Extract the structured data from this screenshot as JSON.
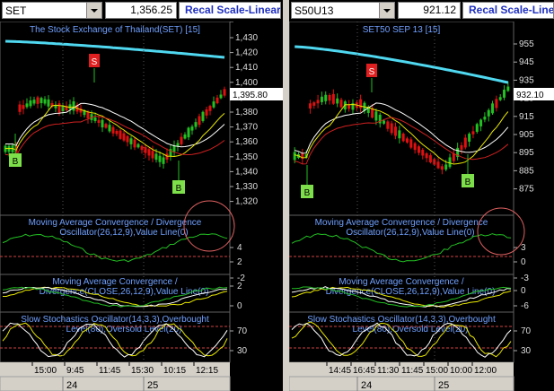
{
  "left": {
    "symbol": "SET",
    "price": "1,356.25",
    "recal_label": "Recal Scale-Linear",
    "main_title": "The Stock Exchange of Thailand(SET) [15]",
    "price_axis": [
      "1,430",
      "1,420",
      "1,410",
      "1,400",
      "1,390",
      "1,380",
      "1,370",
      "1,360",
      "1,350",
      "1,340",
      "1,330",
      "1,320"
    ],
    "last_price_tag": "1,395.80",
    "sell_label": "S",
    "buy_labels": [
      "B",
      "B"
    ],
    "macd_title_1": "Moving Average Convergence / Divergence",
    "macd_title_2": "Oscillator(26,12,9),Value Line(0)",
    "macd_axis": [
      "4",
      "2",
      "-2"
    ],
    "macd2_title_1": "Moving Average Convergence /",
    "macd2_title_2": "Divergence(CLOSE,26,12,9),Value Line(0)",
    "macd2_axis": [
      "2",
      "0",
      "-10"
    ],
    "stoch_title_1": "Slow Stochastics Oscillator(14,3,3),Overbought",
    "stoch_title_2": "Level(80),Oversold Level(20)",
    "stoch_axis": [
      "70",
      "30"
    ],
    "time_labels": [
      "15:00",
      "9:45",
      "11:45",
      "15:30",
      "10:15",
      "12:15"
    ],
    "date_labels": [
      "24",
      "25"
    ]
  },
  "right": {
    "symbol": "S50U13",
    "price": "921.12",
    "recal_label": "Recal Scale-Linea",
    "main_title": "SET50 SEP 13   [15]",
    "price_axis": [
      "955",
      "945",
      "935",
      "925",
      "915",
      "905",
      "895",
      "885",
      "875"
    ],
    "last_price_tag": "932.10",
    "sell_label": "S",
    "buy_labels": [
      "B",
      "B"
    ],
    "macd_title_1": "Moving Average Convergence / Divergence",
    "macd_title_2": "Oscillator(26,12,9),Value Line(0)",
    "macd_axis": [
      "3",
      "0",
      "-3"
    ],
    "macd2_title_1": "Moving Average Convergence /",
    "macd2_title_2": "Divergence(CLOSE,26,12,9),Value Line(0)",
    "macd2_axis": [
      "0",
      "-6"
    ],
    "stoch_title_1": "Slow Stochastics Oscillator(14,3,3),Overbought",
    "stoch_title_2": "Level(80),Oversold Level(20)",
    "stoch_axis": [
      "70",
      "30"
    ],
    "time_labels": [
      "14:45",
      "16:45",
      "11:30",
      "11:45",
      "15:00",
      "10:00",
      "12:00"
    ],
    "date_labels": [
      "24",
      "25"
    ]
  },
  "colors": {
    "up": "#22c022",
    "down": "#e01010",
    "ma_cyan": "#4fd8f0",
    "ma_white": "#ffffff",
    "ma_yellow": "#e8e800",
    "ma_red": "#d02020",
    "title_blue": "#6fa0ff",
    "annotation": "#e06060"
  }
}
